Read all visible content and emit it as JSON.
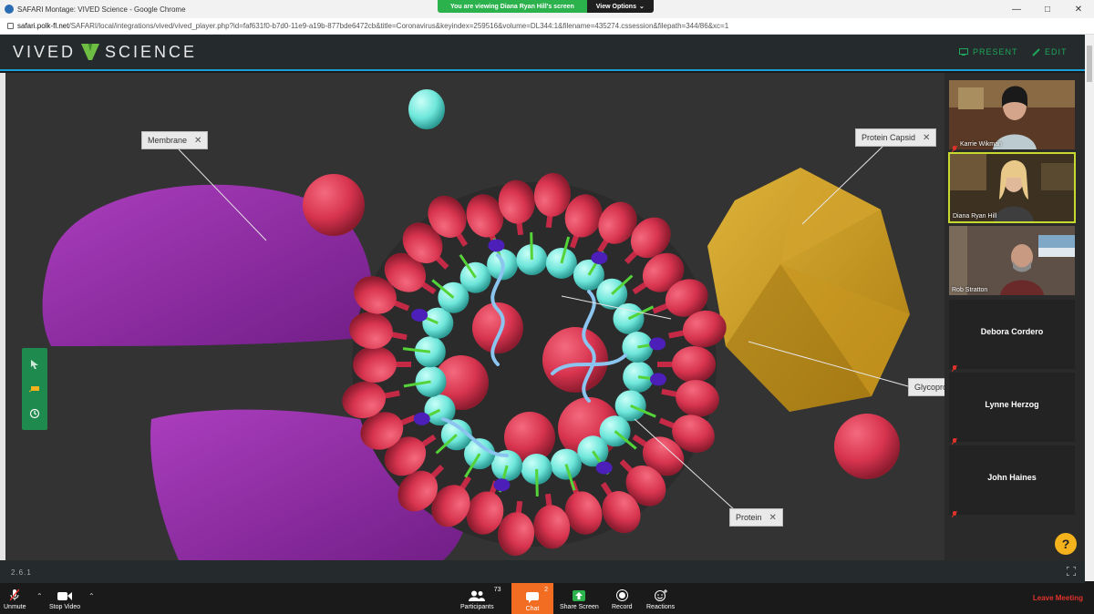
{
  "browser": {
    "window_title": "SAFARI Montage: VIVED Science - Google Chrome",
    "url_host": "safari.polk-fl.net",
    "url_path": "/SAFARI/local/integrations/vived/vived_player.php?id=faf631f0-b7d0-11e9-a19b-877bde6472cb&title=Coronavirus&keyindex=259516&volume=DL344:1&filename=435274.cssession&filepath=344/86&xc=1"
  },
  "share_banner": {
    "message": "You are viewing Diana Ryan Hill's screen",
    "options_label": "View Options"
  },
  "app": {
    "logo_left": "VIVED",
    "logo_right": "SCIENCE",
    "present_label": "PRESENT",
    "edit_label": "EDIT",
    "version": "2.6.1",
    "accent_color": "#1ea65a"
  },
  "scene_labels": {
    "membrane": "Membrane",
    "protein_capsid": "Protein Capsid",
    "glycoprotein": "Glycopro",
    "protein": "Protein"
  },
  "participants_panel": [
    {
      "name": "Karrie Wikman",
      "video": true,
      "active": false
    },
    {
      "name": "Diana Ryan Hill",
      "video": true,
      "active": true
    },
    {
      "name": "Rob Stratton",
      "video": true,
      "active": false
    },
    {
      "name": "Debora Cordero",
      "video": false,
      "active": false
    },
    {
      "name": "Lynne Herzog",
      "video": false,
      "active": false
    },
    {
      "name": "John Haines",
      "video": false,
      "active": false
    }
  ],
  "meeting_bar": {
    "unmute": "Unmute",
    "stop_video": "Stop Video",
    "participants": "Participants",
    "participants_count": "73",
    "chat": "Chat",
    "chat_count": "2",
    "share_screen": "Share Screen",
    "record": "Record",
    "reactions": "Reactions",
    "leave": "Leave Meeting"
  }
}
